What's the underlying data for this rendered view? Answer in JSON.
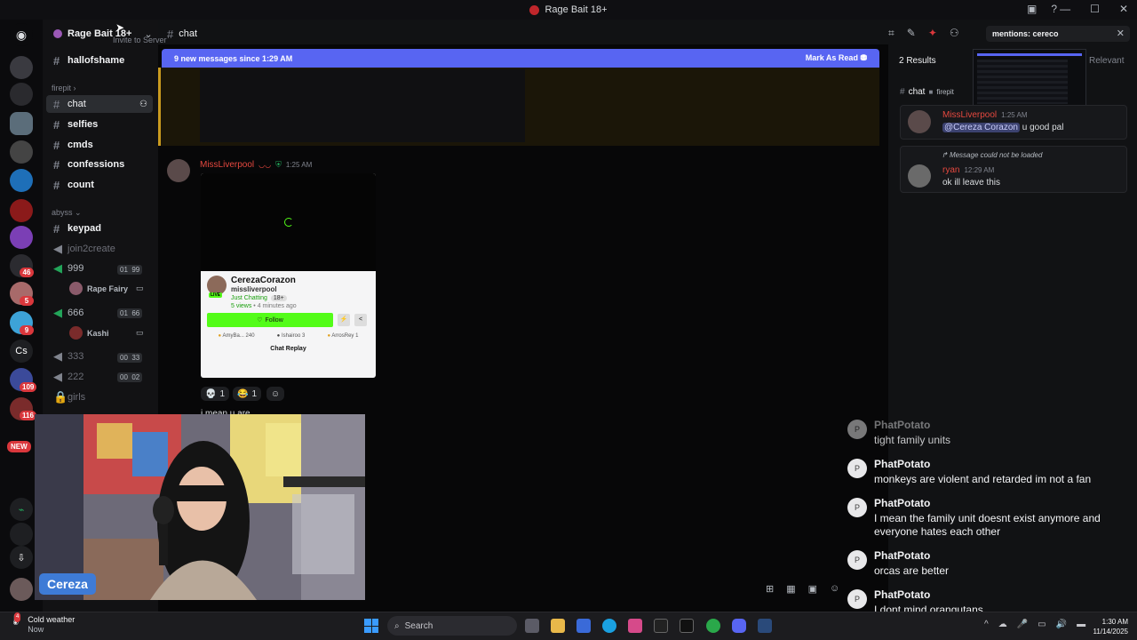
{
  "window": {
    "title": "Rage Bait 18+"
  },
  "server": {
    "name": "Rage Bait 18+",
    "invite_tooltip": "Invite to Server"
  },
  "rail": {
    "badges": [
      "46",
      "5",
      "9",
      "Cs",
      "109",
      "116",
      "NEW"
    ]
  },
  "channels": {
    "top": [
      {
        "name": "hallofshame"
      }
    ],
    "cat_firepit": "firepit",
    "firepit": [
      {
        "name": "chat"
      },
      {
        "name": "selfies"
      },
      {
        "name": "cmds"
      },
      {
        "name": "confessions"
      },
      {
        "name": "count"
      }
    ],
    "cat_abyss": "abyss",
    "abyss": [
      {
        "name": "keypad"
      },
      {
        "name": "join2create"
      },
      {
        "name": "999",
        "count_a": "01",
        "count_b": "99"
      },
      {
        "name": "666",
        "count_a": "01",
        "count_b": "66"
      },
      {
        "name": "333",
        "count_a": "00",
        "count_b": "33"
      },
      {
        "name": "222",
        "count_a": "00",
        "count_b": "02"
      },
      {
        "name": "girls"
      }
    ],
    "voice_users": [
      {
        "name": "Rape Fairy"
      },
      {
        "name": "Kashi"
      }
    ]
  },
  "header": {
    "channel": "chat"
  },
  "search": {
    "query": "mentions: cereco"
  },
  "banner": {
    "text": "9 new messages since 1:29 AM",
    "action": "Mark As Read"
  },
  "message": {
    "author": "MissLiverpool",
    "time": "1:25 AM",
    "card": {
      "streamer": "CerezaCorazon",
      "handle": "missliverpool",
      "category": "Just Chatting",
      "tag": "18+",
      "views": "5 views",
      "ago": "4 minutes ago",
      "live": "LIVE",
      "follow": "Follow",
      "viewers": [
        "AmyBa...",
        "Ishairoo",
        "ArrosRey"
      ],
      "viewer_counts": [
        "240",
        "3",
        "1"
      ],
      "replay": "Chat Replay"
    },
    "reactions": [
      {
        "emoji": "💀",
        "count": "1"
      },
      {
        "emoji": "😂",
        "count": "1"
      }
    ],
    "partial_text": "i mean u are"
  },
  "results": {
    "count": "2 Results",
    "sort": "Relevant",
    "channel": "chat",
    "category": "firepit",
    "items": [
      {
        "author": "MissLiverpool",
        "time": "1:25 AM",
        "mention": "@Cereza Corazon",
        "text": "u good pal"
      },
      {
        "reply_note": "Message could not be loaded",
        "author": "ryan",
        "time": "12:29 AM",
        "text": "ok ill leave this"
      }
    ]
  },
  "cam": {
    "label": "Cereza"
  },
  "overlay_chat": [
    {
      "name": "PhatPotato",
      "text": "tight family units"
    },
    {
      "name": "PhatPotato",
      "text": "monkeys are violent and retarded im not a fan"
    },
    {
      "name": "PhatPotato",
      "text": "I mean the family unit doesnt exist anymore and everyone hates each other"
    },
    {
      "name": "PhatPotato",
      "text": "orcas are better"
    },
    {
      "name": "PhatPotato",
      "text": "I dont mind orangutans"
    }
  ],
  "taskbar": {
    "weather_title": "Cold weather",
    "weather_sub": "Now",
    "weather_badge": "4",
    "search_placeholder": "Search",
    "time": "1:30 AM",
    "date": "11/14/2025"
  },
  "colors": {
    "accent": "#5865f2",
    "kick_green": "#53fc18",
    "username_red": "#e5483f"
  }
}
